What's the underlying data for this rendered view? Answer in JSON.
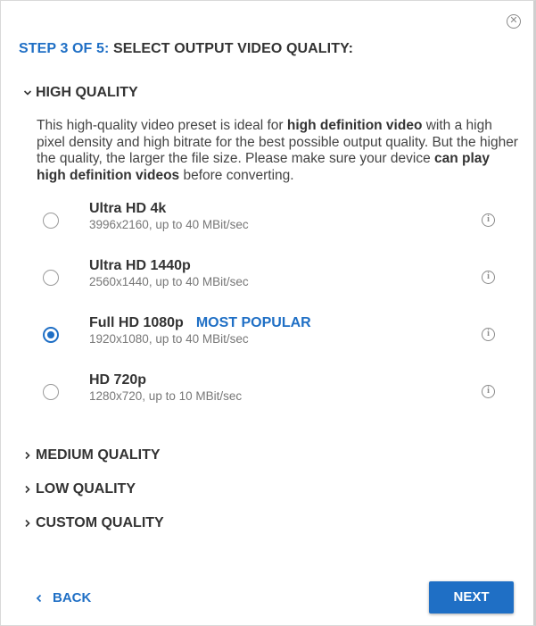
{
  "dialog": {
    "close_icon": "close-circle-icon",
    "step_label": "STEP 3 OF 5:",
    "step_title": "SELECT OUTPUT VIDEO QUALITY:"
  },
  "high_quality": {
    "title": "HIGH QUALITY",
    "expanded": true,
    "description": [
      {
        "text": "This high-quality video preset is ideal for ",
        "bold": false
      },
      {
        "text": "high definition video",
        "bold": true
      },
      {
        "text": " with a high pixel density and high bitrate for the best possible output quality. But the higher the quality, the larger the file size. Please make sure your device ",
        "bold": false
      },
      {
        "text": "can play high definition videos",
        "bold": true
      },
      {
        "text": " before converting.",
        "bold": false
      }
    ],
    "options": [
      {
        "title": "Ultra HD 4k",
        "badge": "",
        "subtitle": "3996x2160, up to 40 MBit/sec",
        "selected": false
      },
      {
        "title": "Ultra HD 1440p",
        "badge": "",
        "subtitle": "2560x1440, up to 40 MBit/sec",
        "selected": false
      },
      {
        "title": "Full HD 1080p",
        "badge": "MOST POPULAR",
        "subtitle": "1920x1080, up to 40 MBit/sec",
        "selected": true
      },
      {
        "title": "HD 720p",
        "badge": "",
        "subtitle": "1280x720, up to 10 MBit/sec",
        "selected": false
      }
    ]
  },
  "sections": [
    {
      "title": "MEDIUM QUALITY",
      "expanded": false
    },
    {
      "title": "LOW QUALITY",
      "expanded": false
    },
    {
      "title": "CUSTOM QUALITY",
      "expanded": false
    }
  ],
  "footer": {
    "back_label": "BACK",
    "next_label": "NEXT"
  },
  "colors": {
    "accent": "#1f6fc5",
    "text": "#333333",
    "muted": "#777777"
  }
}
